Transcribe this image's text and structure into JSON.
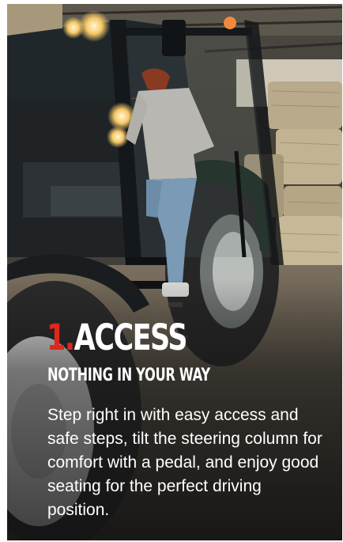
{
  "card": {
    "headline_number": "1.",
    "headline_word": "ACCESS",
    "subheadline": "NOTHING IN YOUR WAY",
    "body": "Step right in with easy access and safe steps, tilt the steering column for comfort with a pedal, and enjoy good seating for the perfect driving position."
  },
  "colors": {
    "accent_red": "#e1261c",
    "text": "#ffffff",
    "tractor_body": "#1f2326",
    "tire": "#2b2b2b",
    "hay": "#b8a98a"
  }
}
